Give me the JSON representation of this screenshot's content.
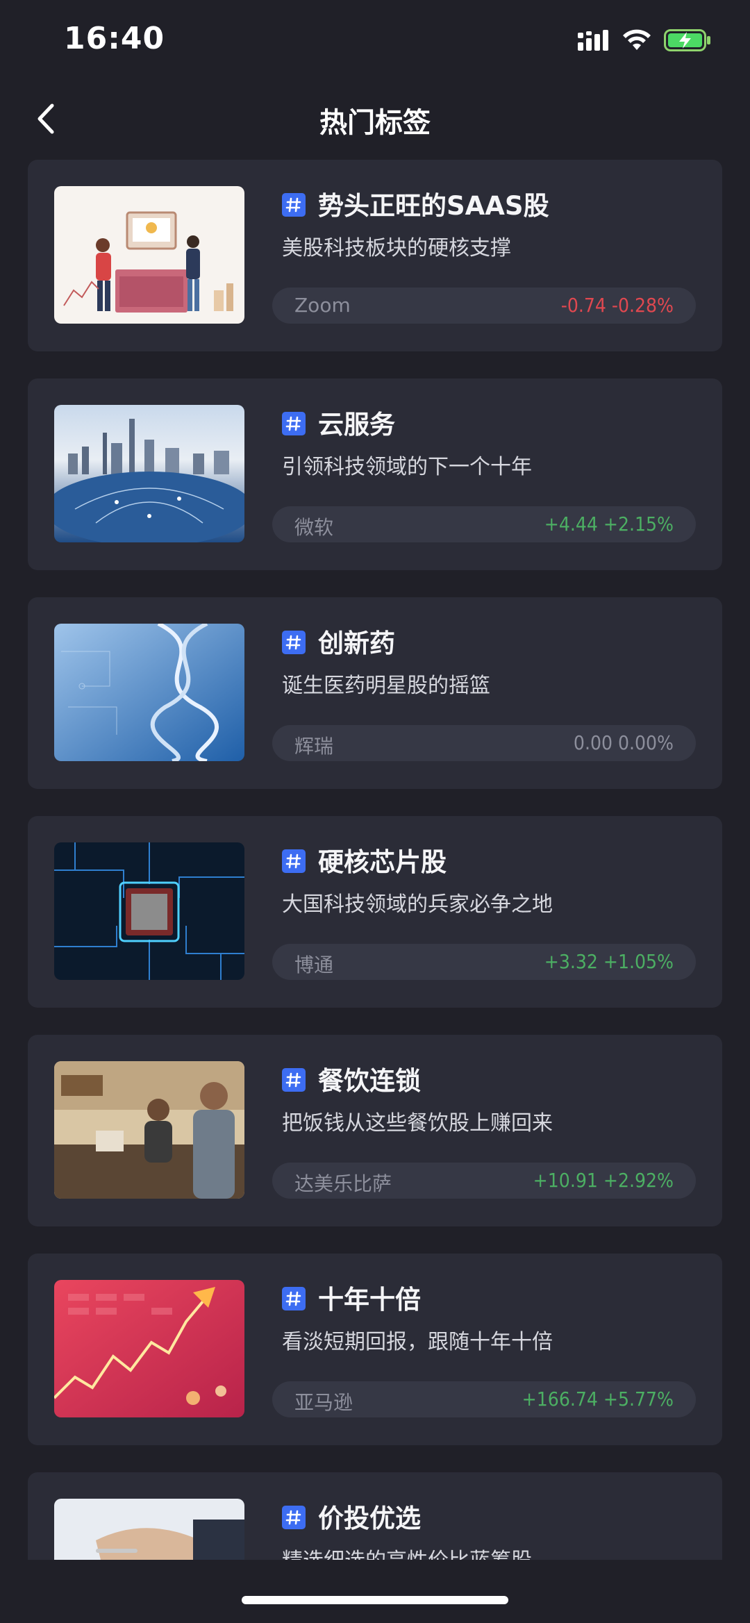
{
  "status_bar": {
    "time": "16:40"
  },
  "nav": {
    "title": "热门标签"
  },
  "colors": {
    "background": "#202028",
    "card": "#2b2c37",
    "pill": "#363845",
    "tag_icon": "#3d6df2",
    "up": "#4caf63",
    "down": "#e04850",
    "flat": "#8d8f9c"
  },
  "cards": [
    {
      "title": "势头正旺的SAAS股",
      "desc": "美股科技板块的硬核支撑",
      "stock": "Zoom",
      "change": "-0.74 -0.28%",
      "trend": "down",
      "image": "saas-illustration"
    },
    {
      "title": "云服务",
      "desc": "引领科技领域的下一个十年",
      "stock": "微软",
      "change": "+4.44 +2.15%",
      "trend": "up",
      "image": "city-network"
    },
    {
      "title": "创新药",
      "desc": "诞生医药明星股的摇篮",
      "stock": "辉瑞",
      "change": "0.00 0.00%",
      "trend": "flat",
      "image": "dna-helix"
    },
    {
      "title": "硬核芯片股",
      "desc": "大国科技领域的兵家必争之地",
      "stock": "博通",
      "change": "+3.32 +1.05%",
      "trend": "up",
      "image": "circuit-chip"
    },
    {
      "title": "餐饮连锁",
      "desc": "把饭钱从这些餐饮股上赚回来",
      "stock": "达美乐比萨",
      "change": "+10.91 +2.92%",
      "trend": "up",
      "image": "cafe-counter"
    },
    {
      "title": "十年十倍",
      "desc": "看淡短期回报，跟随十年十倍",
      "stock": "亚马逊",
      "change": "+166.74 +5.77%",
      "trend": "up",
      "image": "stock-chart-arrow"
    },
    {
      "title": "价投优选",
      "desc": "精选细选的高性价比蓝筹股",
      "stock": "",
      "change": "",
      "trend": "flat",
      "image": "handshake"
    }
  ]
}
